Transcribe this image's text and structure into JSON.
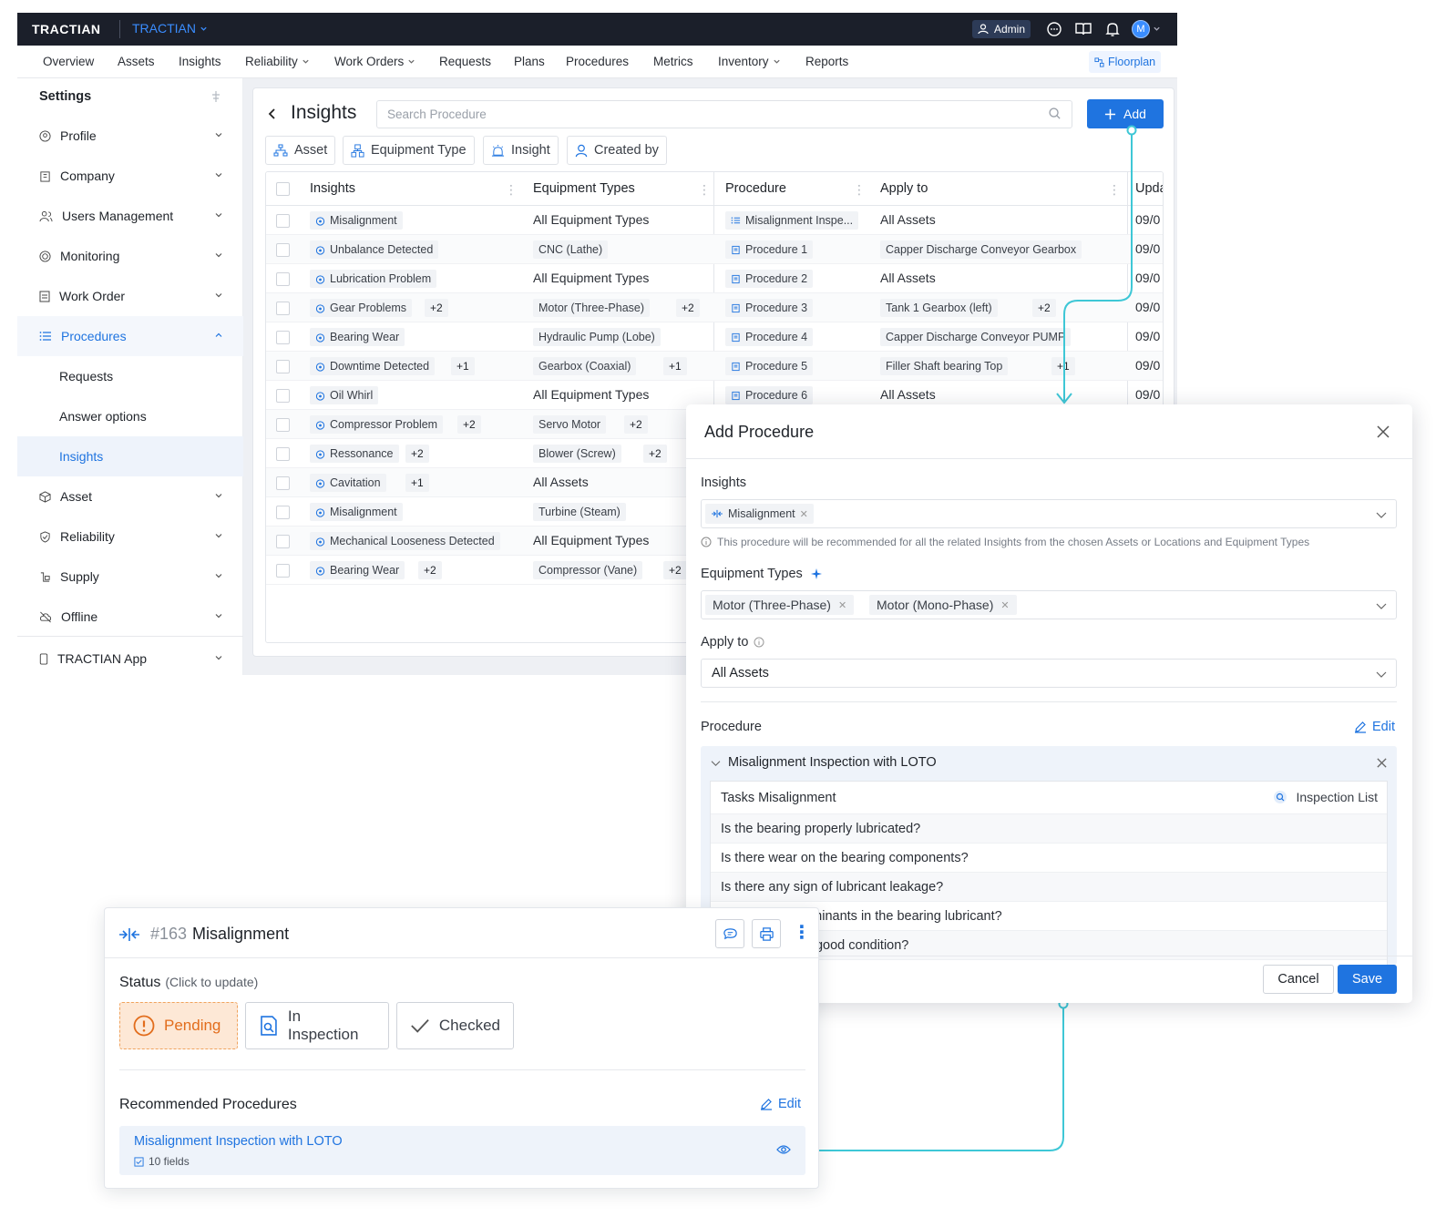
{
  "topbar": {
    "logo": "TRACTIAN",
    "org": "TRACTIAN",
    "admin_label": "Admin",
    "avatar_initial": "M"
  },
  "nav": {
    "items": [
      "Overview",
      "Assets",
      "Insights",
      "Reliability",
      "Work Orders",
      "Requests",
      "Plans",
      "Procedures",
      "Metrics",
      "Inventory",
      "Reports"
    ],
    "floorplan": "Floorplan"
  },
  "sidebar": {
    "title": "Settings",
    "items": [
      "Profile",
      "Company",
      "Users Management",
      "Monitoring",
      "Work Order",
      "Procedures",
      "Requests",
      "Answer options",
      "Insights",
      "Asset",
      "Reliability",
      "Supply",
      "Offline",
      "TRACTIAN App"
    ]
  },
  "page": {
    "title": "Insights",
    "search_placeholder": "Search Procedure",
    "add_label": "Add",
    "filters": [
      "Asset",
      "Equipment Type",
      "Insight",
      "Created by"
    ]
  },
  "table": {
    "headers": [
      "Insights",
      "Equipment Types",
      "Procedure",
      "Apply to",
      "Upda"
    ],
    "rows": [
      {
        "insight": "Misalignment",
        "insight_plus": "",
        "eq": "All Equipment Types",
        "eq_tag": false,
        "eq_plus": "",
        "proc": "Misalignment Inspe...",
        "proc_icon": "list",
        "apply": "All Assets",
        "apply_tag": false,
        "apply_plus": "",
        "date": "09/0"
      },
      {
        "insight": "Unbalance Detected",
        "insight_plus": "",
        "eq": "CNC (Lathe)",
        "eq_tag": true,
        "eq_plus": "",
        "proc": "Procedure 1",
        "proc_icon": "doc",
        "apply": "Capper Discharge Conveyor Gearbox",
        "apply_tag": true,
        "apply_plus": "",
        "date": "09/0"
      },
      {
        "insight": "Lubrication Problem",
        "insight_plus": "",
        "eq": "All Equipment Types",
        "eq_tag": false,
        "eq_plus": "",
        "proc": "Procedure 2",
        "proc_icon": "doc",
        "apply": "All Assets",
        "apply_tag": false,
        "apply_plus": "",
        "date": "09/0"
      },
      {
        "insight": "Gear Problems",
        "insight_plus": "+2",
        "eq": "Motor (Three-Phase)",
        "eq_tag": true,
        "eq_plus": "+2",
        "proc": "Procedure 3",
        "proc_icon": "doc",
        "apply": "Tank 1 Gearbox (left)",
        "apply_tag": true,
        "apply_plus": "+2",
        "date": "09/0"
      },
      {
        "insight": "Bearing Wear",
        "insight_plus": "",
        "eq": "Hydraulic Pump (Lobe)",
        "eq_tag": true,
        "eq_plus": "",
        "proc": "Procedure 4",
        "proc_icon": "doc",
        "apply": "Capper Discharge Conveyor PUMP",
        "apply_tag": true,
        "apply_plus": "",
        "date": "09/0"
      },
      {
        "insight": "Downtime Detected",
        "insight_plus": "+1",
        "eq": "Gearbox (Coaxial)",
        "eq_tag": true,
        "eq_plus": "+1",
        "proc": "Procedure 5",
        "proc_icon": "doc",
        "apply": "Filler Shaft bearing Top",
        "apply_tag": true,
        "apply_plus": "+1",
        "date": "09/0"
      },
      {
        "insight": "Oil Whirl",
        "insight_plus": "",
        "eq": "All Equipment Types",
        "eq_tag": false,
        "eq_plus": "",
        "proc": "Procedure 6",
        "proc_icon": "doc",
        "apply": "All Assets",
        "apply_tag": false,
        "apply_plus": "",
        "date": "09/0"
      },
      {
        "insight": "Compressor Problem",
        "insight_plus": "+2",
        "eq": "Servo Motor",
        "eq_tag": true,
        "eq_plus": "+2"
      },
      {
        "insight": "Ressonance",
        "insight_plus": "+2",
        "eq": "Blower (Screw)",
        "eq_tag": true,
        "eq_plus": "+2"
      },
      {
        "insight": "Cavitation",
        "insight_plus": "+1",
        "eq": "All Assets",
        "eq_tag": false,
        "eq_plus": ""
      },
      {
        "insight": "Misalignment",
        "insight_plus": "",
        "eq": "Turbine (Steam)",
        "eq_tag": true,
        "eq_plus": ""
      },
      {
        "insight": "Mechanical Looseness Detected",
        "insight_plus": "",
        "eq": "All Equipment Types",
        "eq_tag": false,
        "eq_plus": ""
      },
      {
        "insight": "Bearing Wear",
        "insight_plus": "+2",
        "eq": "Compressor (Vane)",
        "eq_tag": true,
        "eq_plus": "+2"
      }
    ]
  },
  "modal": {
    "title": "Add Procedure",
    "insights_label": "Insights",
    "insights_chip": "Misalignment",
    "hint": "This procedure will be recommended for all the related Insights from the chosen Assets or Locations and Equipment Types",
    "eq_label": "Equipment Types",
    "eq_chips": [
      "Motor (Three-Phase)",
      "Motor (Mono-Phase)"
    ],
    "apply_label": "Apply to",
    "apply_value": "All Assets",
    "procedure_label": "Procedure",
    "edit_label": "Edit",
    "procedure_name": "Misalignment Inspection with LOTO",
    "tasks_header": "Tasks Misalignment",
    "inspection_list": "Inspection List",
    "tasks": [
      "Is the bearing properly lubricated?",
      "Is there wear on the bearing components?",
      "Is there any sign of lubricant leakage?",
      "Are there contaminants in the bearing lubricant?",
      "Are the seals in good condition?"
    ],
    "cancel": "Cancel",
    "save": "Save"
  },
  "card": {
    "id": "#163",
    "title": "Misalignment",
    "status_label": "Status",
    "status_hint": "(Click to update)",
    "statuses": [
      "Pending",
      "In Inspection",
      "Checked"
    ],
    "rec_label": "Recommended Procedures",
    "edit_label": "Edit",
    "rec_name": "Misalignment Inspection with LOTO",
    "rec_fields": "10 fields"
  },
  "colors": {
    "accent": "#1f74e0",
    "topbar": "#1b1f2a",
    "connector": "#3ec7d6",
    "pending": "#e26d1c"
  }
}
